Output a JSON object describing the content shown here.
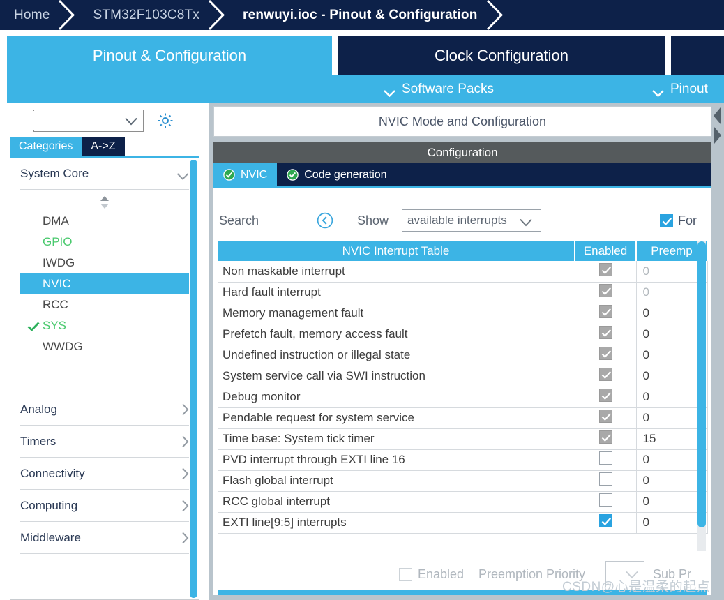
{
  "breadcrumb": {
    "items": [
      {
        "label": "Home",
        "active": false
      },
      {
        "label": "STM32F103C8Tx",
        "active": false
      },
      {
        "label": "renwuyi.ioc - Pinout & Configuration",
        "active": true
      }
    ]
  },
  "main_tabs": [
    {
      "label": "Pinout & Configuration",
      "selected": true
    },
    {
      "label": "Clock Configuration",
      "selected": false
    },
    {
      "label": "",
      "selected": false
    }
  ],
  "sub_strip": {
    "software_packs": "Software Packs",
    "pinout": "Pinout",
    "chevron_icon": "chevron-down-icon"
  },
  "left_panel": {
    "search": {
      "value": "",
      "placeholder": "",
      "icon": "search-icon"
    },
    "gear_icon": "gear-icon",
    "view_tabs": [
      {
        "label": "Categories",
        "selected": true
      },
      {
        "label": "A->Z",
        "selected": false
      }
    ],
    "groups": [
      {
        "label": "System Core",
        "expanded": true,
        "items": [
          {
            "label": "DMA",
            "state": "normal",
            "selected": false
          },
          {
            "label": "GPIO",
            "state": "configured",
            "selected": false
          },
          {
            "label": "IWDG",
            "state": "normal",
            "selected": false
          },
          {
            "label": "NVIC",
            "state": "normal",
            "selected": true
          },
          {
            "label": "RCC",
            "state": "normal",
            "selected": false
          },
          {
            "label": "SYS",
            "state": "configured",
            "selected": false,
            "check": true
          },
          {
            "label": "WWDG",
            "state": "normal",
            "selected": false
          }
        ]
      },
      {
        "label": "Analog",
        "expanded": false,
        "items": []
      },
      {
        "label": "Timers",
        "expanded": false,
        "items": []
      },
      {
        "label": "Connectivity",
        "expanded": false,
        "items": []
      },
      {
        "label": "Computing",
        "expanded": false,
        "items": []
      },
      {
        "label": "Middleware",
        "expanded": false,
        "items": []
      }
    ]
  },
  "right_panel": {
    "mode_header": "NVIC Mode and Configuration",
    "configuration_title": "Configuration",
    "config_tabs": [
      {
        "label": "NVIC",
        "selected": true,
        "badge": "ok-check-icon"
      },
      {
        "label": "Code generation",
        "selected": false,
        "badge": "ok-check-icon"
      }
    ],
    "toolbar": {
      "search_label": "Search",
      "search_toggle_icon": "collapse-left-circle-icon",
      "show_label": "Show",
      "show_value": "available interrupts",
      "force_label": "For",
      "force_checked": true
    },
    "table": {
      "columns": [
        "NVIC Interrupt Table",
        "Enabled",
        "Preemp"
      ],
      "rows": [
        {
          "name": "Non maskable interrupt",
          "enabled": true,
          "locked": true,
          "priority": "0",
          "dim": true
        },
        {
          "name": "Hard fault interrupt",
          "enabled": true,
          "locked": true,
          "priority": "0",
          "dim": true
        },
        {
          "name": "Memory management fault",
          "enabled": true,
          "locked": true,
          "priority": "0",
          "dim": false
        },
        {
          "name": "Prefetch fault, memory access fault",
          "enabled": true,
          "locked": true,
          "priority": "0",
          "dim": false
        },
        {
          "name": "Undefined instruction or illegal state",
          "enabled": true,
          "locked": true,
          "priority": "0",
          "dim": false
        },
        {
          "name": "System service call via SWI instruction",
          "enabled": true,
          "locked": true,
          "priority": "0",
          "dim": false
        },
        {
          "name": "Debug monitor",
          "enabled": true,
          "locked": true,
          "priority": "0",
          "dim": false
        },
        {
          "name": "Pendable request for system service",
          "enabled": true,
          "locked": true,
          "priority": "0",
          "dim": false
        },
        {
          "name": "Time base: System tick timer",
          "enabled": true,
          "locked": true,
          "priority": "15",
          "dim": false
        },
        {
          "name": "PVD interrupt through EXTI line 16",
          "enabled": false,
          "locked": false,
          "priority": "0",
          "dim": false
        },
        {
          "name": "Flash global interrupt",
          "enabled": false,
          "locked": false,
          "priority": "0",
          "dim": false
        },
        {
          "name": "RCC global interrupt",
          "enabled": false,
          "locked": false,
          "priority": "0",
          "dim": false
        },
        {
          "name": "EXTI line[9:5] interrupts",
          "enabled": true,
          "locked": false,
          "priority": "0",
          "dim": false
        }
      ]
    },
    "footer": {
      "enabled_label": "Enabled",
      "enabled_checked": false,
      "preemption_label": "Preemption Priority",
      "preemption_value": "",
      "sub_label": "Sub Pr"
    }
  },
  "watermark": "CSDN@心是温柔的起点"
}
